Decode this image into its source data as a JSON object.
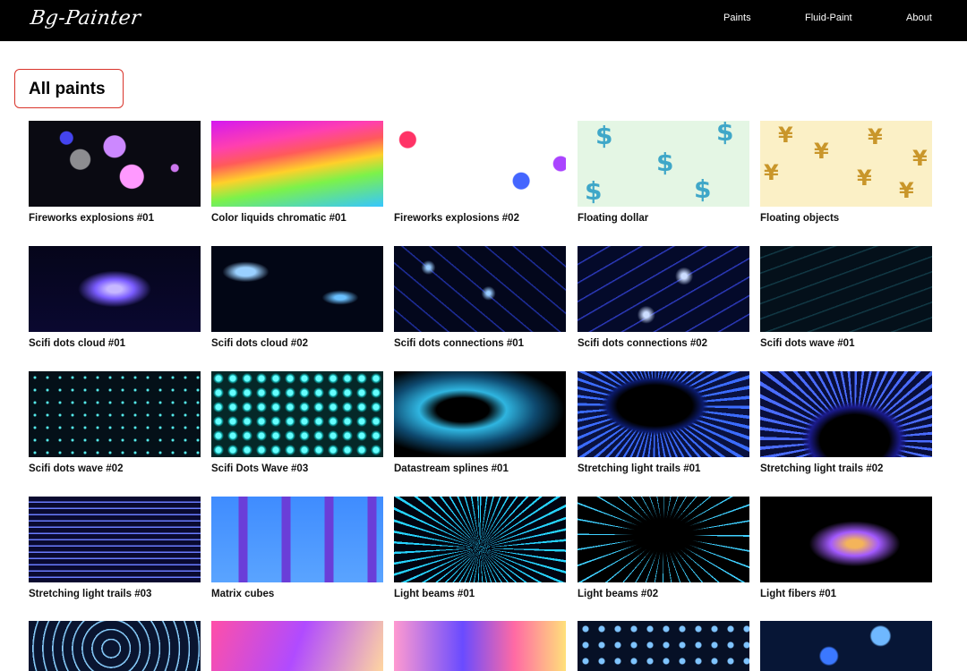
{
  "header": {
    "logo_text": "Bg-Painter",
    "nav": [
      "Paints",
      "Fluid-Paint",
      "About"
    ]
  },
  "page": {
    "title": "All paints"
  },
  "colors": {
    "header_bg": "#000000",
    "title_box_border": "#d9342b"
  },
  "paints": [
    {
      "name": "Fireworks explosions #01"
    },
    {
      "name": "Color liquids chromatic #01"
    },
    {
      "name": "Fireworks explosions #02"
    },
    {
      "name": "Floating dollar"
    },
    {
      "name": "Floating objects"
    },
    {
      "name": "Scifi dots cloud #01"
    },
    {
      "name": "Scifi dots cloud #02"
    },
    {
      "name": "Scifi dots connections #01"
    },
    {
      "name": "Scifi dots connections #02"
    },
    {
      "name": "Scifi dots wave #01"
    },
    {
      "name": "Scifi dots wave #02"
    },
    {
      "name": "Scifi Dots Wave #03"
    },
    {
      "name": "Datastream splines #01"
    },
    {
      "name": "Stretching light trails #01"
    },
    {
      "name": "Stretching light trails #02"
    },
    {
      "name": "Stretching light trails #03"
    },
    {
      "name": "Matrix cubes"
    },
    {
      "name": "Light beams #01"
    },
    {
      "name": "Light beams #02"
    },
    {
      "name": "Light fibers #01"
    }
  ]
}
